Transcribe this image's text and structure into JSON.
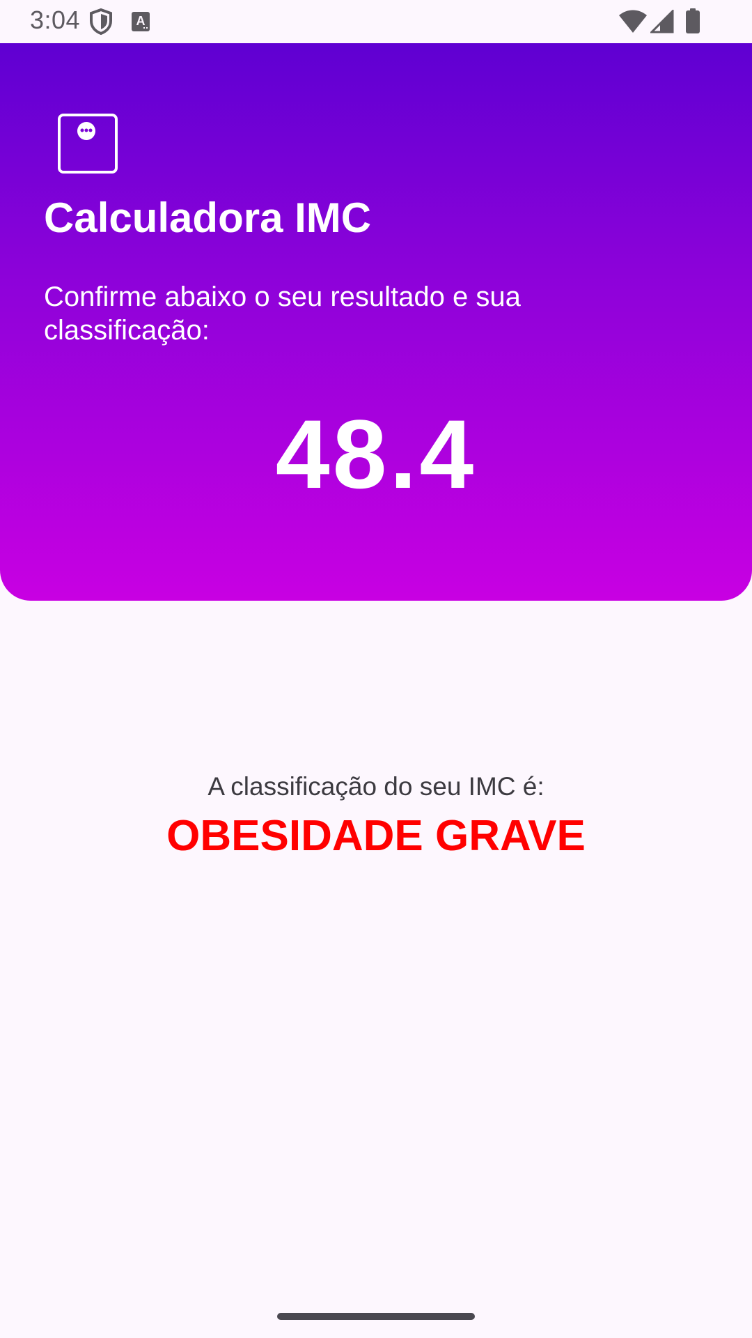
{
  "status_bar": {
    "time": "3:04",
    "left_icons": [
      "shield-icon",
      "keyboard-a-icon"
    ],
    "right_icons": [
      "wifi-icon",
      "cell-signal-icon",
      "battery-icon"
    ]
  },
  "header": {
    "icon": "scale-icon",
    "title": "Calculadora IMC",
    "subtitle": "Confirme abaixo o seu resultado e sua classificação:",
    "bmi_value": "48.4",
    "gradient_colors": [
      "#5f00d2",
      "#8b02d9",
      "#c800e2"
    ]
  },
  "result": {
    "label": "A classificação do seu IMC é:",
    "classification": "OBESIDADE GRAVE",
    "classification_color": "#ff0000"
  }
}
